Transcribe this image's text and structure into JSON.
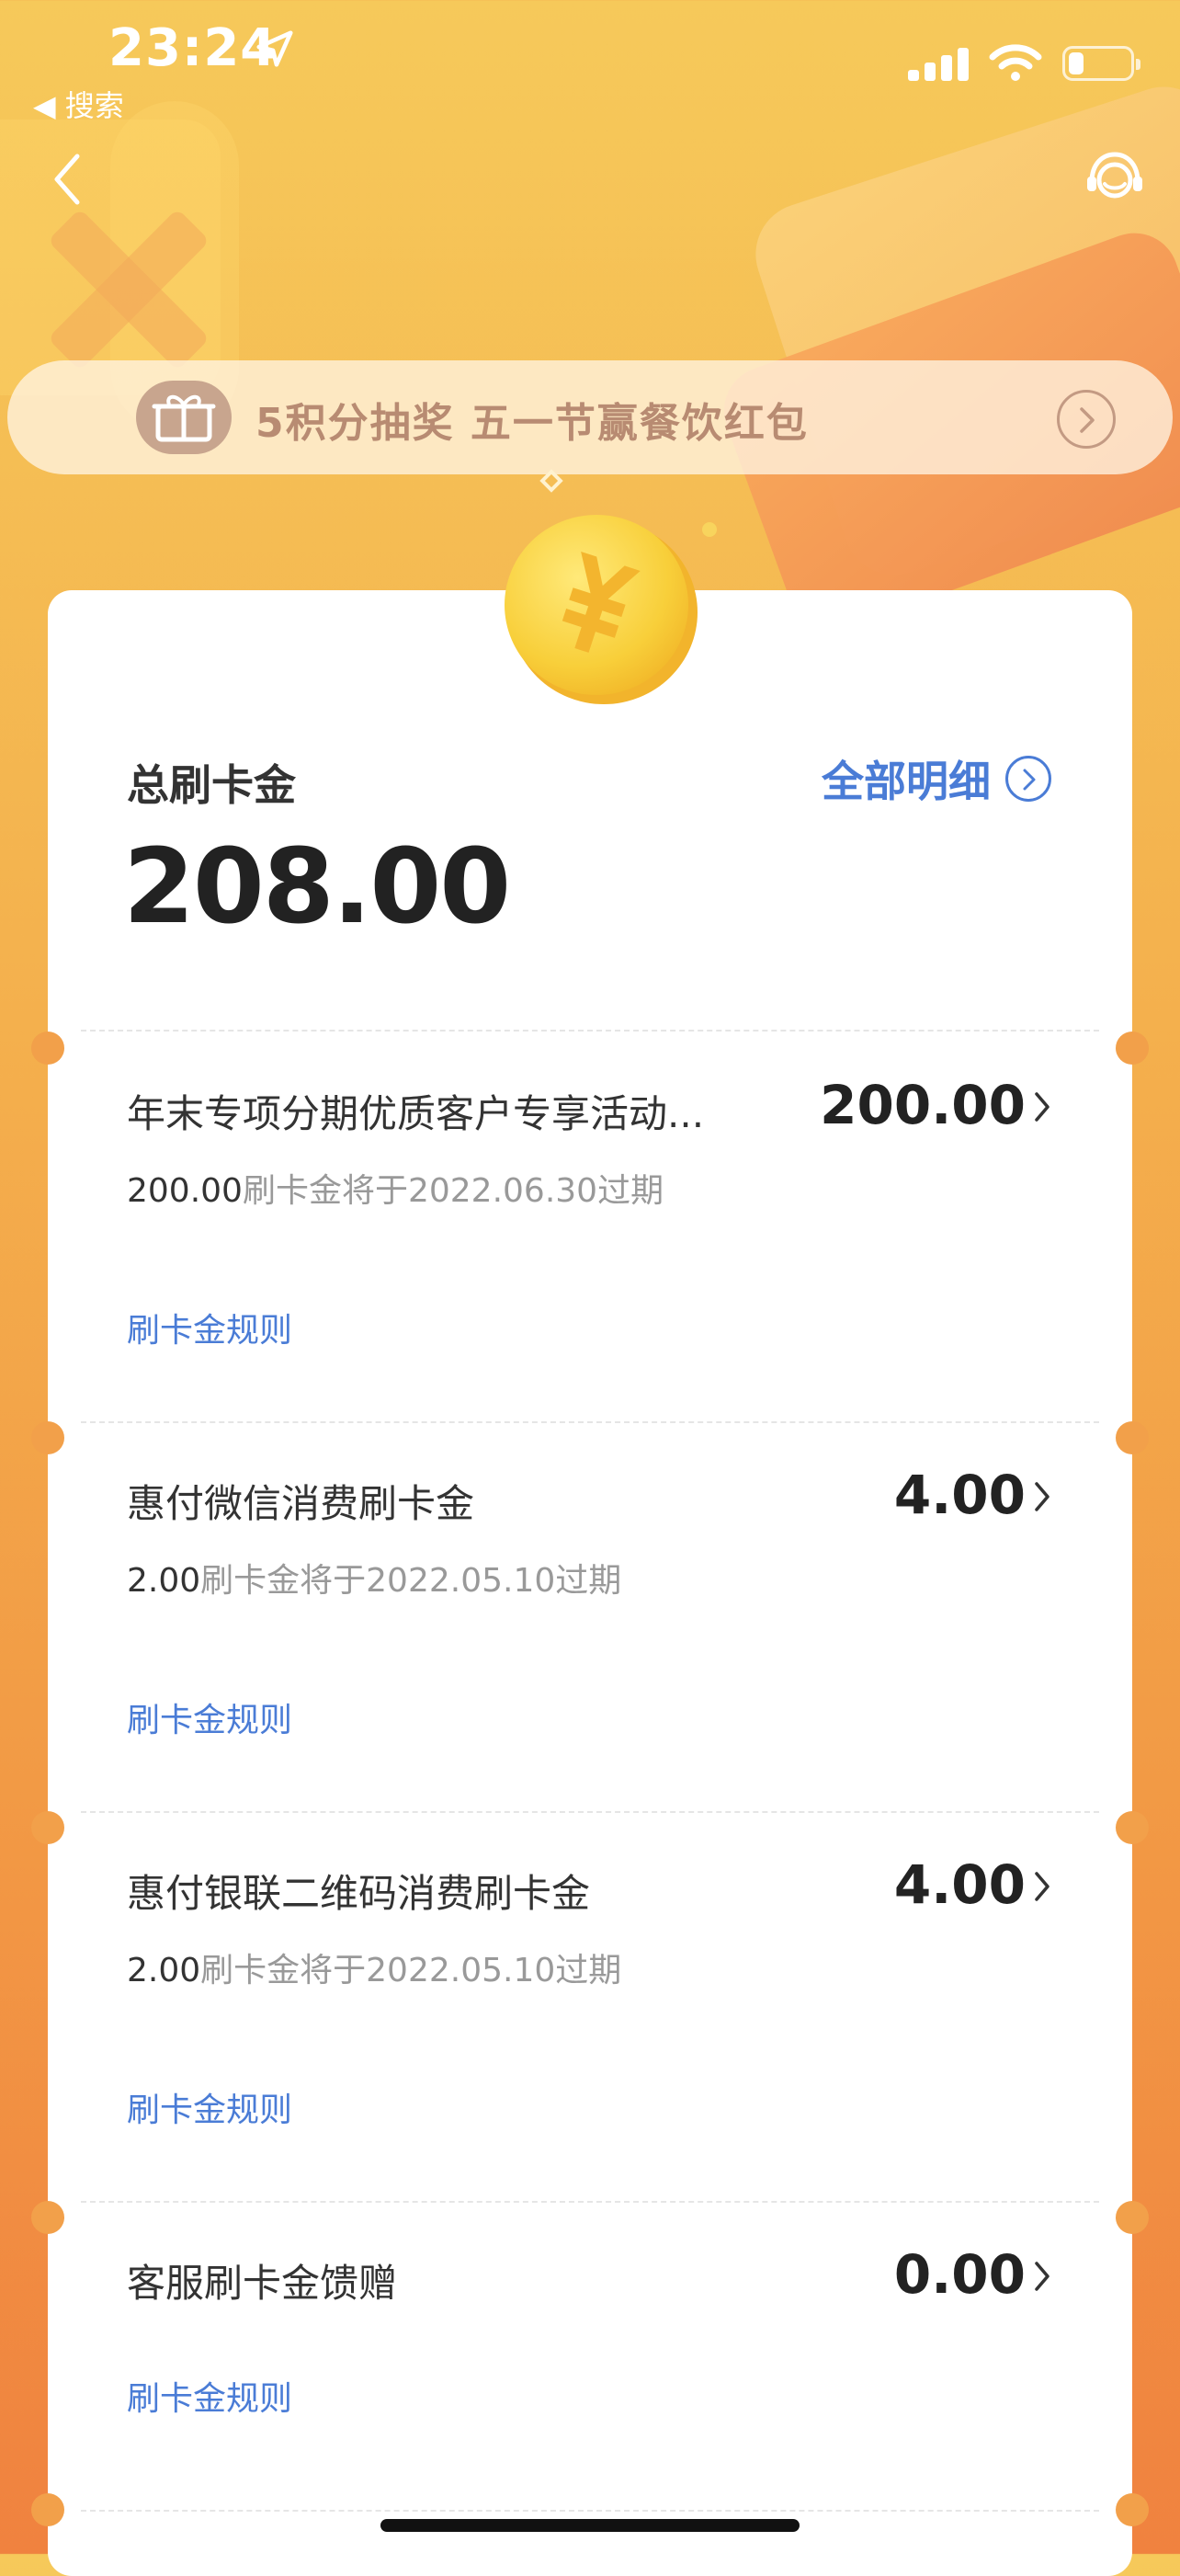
{
  "status_bar": {
    "time": "23:24",
    "back_app": "◀ 搜索",
    "battery_percent": 25
  },
  "promo": {
    "text": "5积分抽奖  五一节赢餐饮红包"
  },
  "summary": {
    "label": "总刷卡金",
    "total": "208.00",
    "details_link": "全部明细"
  },
  "items": [
    {
      "title": "年末专项分期优质客户专享活动...",
      "amount": "200.00",
      "expiry_amount": "200.00",
      "expiry_text": "刷卡金将于2022.06.30过期",
      "rule": "刷卡金规则"
    },
    {
      "title": "惠付微信消费刷卡金",
      "amount": "4.00",
      "expiry_amount": "2.00",
      "expiry_text": "刷卡金将于2022.05.10过期",
      "rule": "刷卡金规则"
    },
    {
      "title": "惠付银联二维码消费刷卡金",
      "amount": "4.00",
      "expiry_amount": "2.00",
      "expiry_text": "刷卡金将于2022.05.10过期",
      "rule": "刷卡金规则"
    },
    {
      "title": "客服刷卡金馈赠",
      "amount": "0.00",
      "rule": "刷卡金规则"
    }
  ],
  "colors": {
    "accent_blue": "#4a7cd6",
    "background_top": "#f6c95a",
    "background_bottom": "#f0823f"
  },
  "icons": {
    "back": "chevron-left-icon",
    "service": "customer-service-icon",
    "promo": "gift-icon",
    "coin": "yuan-coin-icon"
  }
}
